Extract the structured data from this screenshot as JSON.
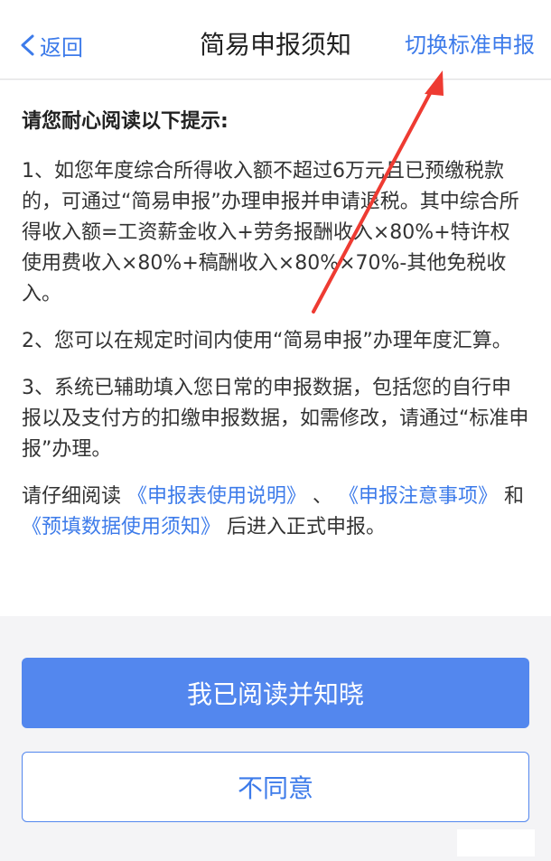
{
  "nav": {
    "back_label": "返回",
    "title": "简易申报须知",
    "switch_label": "切换标准申报"
  },
  "notice": {
    "heading": "请您耐心阅读以下提示:",
    "items": [
      "1、如您年度综合所得收入额不超过6万元且已预缴税款的，可通过“简易申报”办理申报并申请退税。其中综合所得收入额=工资薪金收入+劳务报酬收入×80%+特许权使用费收入×80%+稿酬收入×80%×70%-其他免税收入。",
      "2、您可以在规定时间内使用“简易申报”办理年度汇算。",
      "3、系统已辅助填入您日常的申报数据，包括您的自行申报以及支付方的扣缴申报数据，如需修改，请通过“标准申报”办理。"
    ],
    "read_prefix": "请仔细阅读 ",
    "link1": "《申报表使用说明》",
    "sep1": " 、 ",
    "link2": "《申报注意事项》",
    "sep2": " 和 ",
    "link3": "《预填数据使用须知》",
    "read_suffix": " 后进入正式申报。"
  },
  "buttons": {
    "agree": "我已阅读并知晓",
    "disagree": "不同意"
  },
  "icons": {
    "back": "chevron-left-icon"
  },
  "colors": {
    "accent": "#3d7bea",
    "primary_button": "#5387ee",
    "annotation_arrow": "#ee3b32"
  }
}
